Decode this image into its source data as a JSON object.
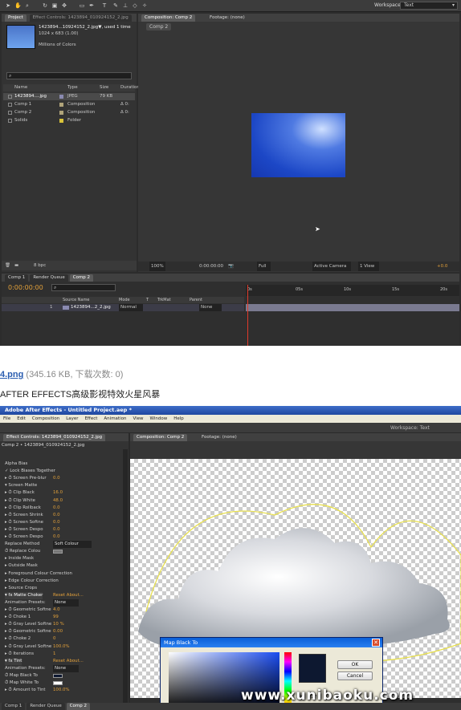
{
  "screen1": {
    "workspace_label": "Workspace:",
    "workspace_value": "Text",
    "project_tab": "Project",
    "effect_tab": "Effect Controls: 1423894_010924152_2.jpg",
    "file_name": "1423894...10924152_2.jpg▼, used 1 time",
    "file_dims": "1024 x 683 (1.00)",
    "file_colors": "Millions of Colors",
    "col_name": "Name",
    "col_type": "Type",
    "col_size": "Size",
    "col_duration": "Duration",
    "items": [
      {
        "name": "1423894....jpg",
        "type": "JPEG",
        "size": "79 KB",
        "dur": "",
        "color": "#8a8ab0"
      },
      {
        "name": "Comp 1",
        "type": "Composition",
        "size": "",
        "dur": "Δ 0:",
        "color": "#b0a47a"
      },
      {
        "name": "Comp 2",
        "type": "Composition",
        "size": "",
        "dur": "Δ 0:",
        "color": "#b0a47a"
      },
      {
        "name": "Solids",
        "type": "Folder",
        "size": "",
        "dur": "",
        "color": "#d8c23a"
      }
    ],
    "bpc": "8 bpc",
    "comp_tab": "Composition: Comp 2",
    "footage_tab": "Footage: (none)",
    "comp_chip": "Comp 2",
    "viewer_bar": {
      "zoom": "100%",
      "time": "0:00:00:00",
      "resolution": "Full",
      "camera": "Active Camera",
      "views": "1 View",
      "exposure": "+0.0"
    },
    "tl_tabs": [
      "Comp 1",
      "Render Queue",
      "Comp 2"
    ],
    "tl_time": "0:00:00:00",
    "tl_cols": {
      "source": "Source Name",
      "mode": "Mode",
      "t": "T",
      "trkmat": "TrkMat",
      "parent": "Parent"
    },
    "ruler": [
      "0s",
      "05s",
      "10s",
      "15s",
      "20s"
    ],
    "layer": {
      "num": "1",
      "name": "1423894...2_2.jpg",
      "mode": "Normal",
      "parent": "None"
    }
  },
  "caption": {
    "file_link": "4.png",
    "file_info": "(345.16 KB, 下载次数: 0)",
    "title": "AFTER EFFECTS高级影视特效火星风暴"
  },
  "screen2": {
    "title": "Adobe After Effects - Untitled Project.aep *",
    "menu": [
      "File",
      "Edit",
      "Composition",
      "Layer",
      "Effect",
      "Animation",
      "View",
      "Window",
      "Help"
    ],
    "workspace": "Workspace: Text",
    "effect_tab": "Effect Controls: 1423894_010924152_2.jpg",
    "comp_tab": "Composition: Comp 2",
    "footage_tab": "Footage: (none)",
    "breadcrumb": "Comp 2 • 1423894_010924152_2.jpg",
    "rows": [
      {
        "t": "Alpha Bias",
        "v": "",
        "c": ""
      },
      {
        "t": "✓ Lock Biases Together",
        "v": "",
        "c": ""
      },
      {
        "t": "▸ ⏱ Screen Pre-blur",
        "v": "0.0",
        "c": "org"
      },
      {
        "t": "▾ Screen Matte",
        "v": "",
        "c": ""
      },
      {
        "t": "  ▸ ⏱ Clip Black",
        "v": "16.0",
        "c": "org"
      },
      {
        "t": "  ▸ ⏱ Clip White",
        "v": "48.0",
        "c": "org"
      },
      {
        "t": "  ▸ ⏱ Clip Rollback",
        "v": "0.0",
        "c": "org"
      },
      {
        "t": "  ▸ ⏱ Screen Shrink",
        "v": "0.0",
        "c": "org"
      },
      {
        "t": "  ▸ ⏱ Screen Softne",
        "v": "0.0",
        "c": "org"
      },
      {
        "t": "  ▸ ⏱ Screen Despo",
        "v": "0.0",
        "c": "org"
      },
      {
        "t": "  ▸ ⏱ Screen Despo",
        "v": "0.0",
        "c": "org"
      },
      {
        "t": "  Replace Method",
        "v": "Soft Colour",
        "c": "drop"
      },
      {
        "t": "  ⏱ Replace Colou",
        "v": "",
        "c": "sw"
      },
      {
        "t": "▸ Inside Mask",
        "v": "",
        "c": ""
      },
      {
        "t": "▸ Outside Mask",
        "v": "",
        "c": ""
      },
      {
        "t": "▸ Foreground Colour Correction",
        "v": "",
        "c": ""
      },
      {
        "t": "▸ Edge Colour Correction",
        "v": "",
        "c": ""
      },
      {
        "t": "▸ Source Crops",
        "v": "",
        "c": ""
      },
      {
        "t": "▾ fx Matte Choker",
        "v": "Reset   About...",
        "c": "fxh"
      },
      {
        "t": "  Animation Presets:",
        "v": "None",
        "c": "drop"
      },
      {
        "t": "▸ ⏱ Geometric Softne",
        "v": "4.0",
        "c": "org"
      },
      {
        "t": "▸ ⏱ Choke 1",
        "v": "99",
        "c": "org"
      },
      {
        "t": "▸ ⏱ Gray Level Softne",
        "v": "10 %",
        "c": "org"
      },
      {
        "t": "▸ ⏱ Geometric Softne",
        "v": "0.00",
        "c": "org"
      },
      {
        "t": "▸ ⏱ Choke 2",
        "v": "0",
        "c": "org"
      },
      {
        "t": "▸ ⏱ Gray Level Softne",
        "v": "100.0%",
        "c": "org"
      },
      {
        "t": "▸ ⏱ Iterations",
        "v": "1",
        "c": "org"
      },
      {
        "t": "▾ fx Tint",
        "v": "Reset   About...",
        "c": "fxh"
      },
      {
        "t": "  Animation Presets:",
        "v": "None",
        "c": "drop"
      },
      {
        "t": "  ⏱ Map Black To",
        "v": "",
        "c": "swd"
      },
      {
        "t": "  ⏱ Map White To",
        "v": "",
        "c": "sww"
      },
      {
        "t": "▸ ⏱ Amount to Tint",
        "v": "100.0%",
        "c": "org"
      }
    ],
    "dialog": {
      "title": "Map Black To",
      "ok": "OK",
      "cancel": "Cancel",
      "h_label": "H:",
      "h_value": "227"
    },
    "bottom_tabs": [
      "Comp 1",
      "Render Queue",
      "Comp 2"
    ],
    "watermark": "www.xunibaoku.com"
  }
}
